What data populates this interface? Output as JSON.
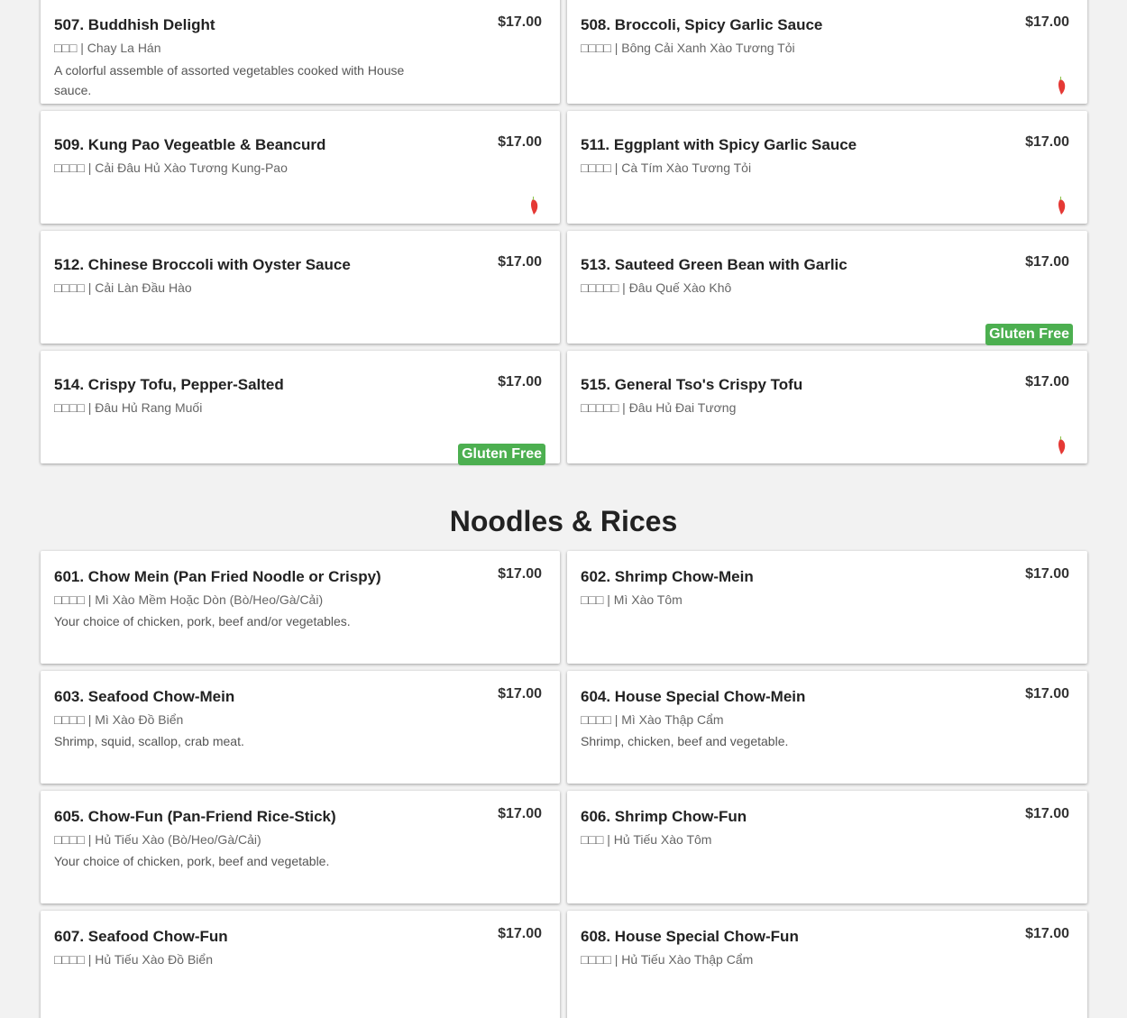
{
  "sections": [
    {
      "title": "",
      "items": [
        {
          "name": "507. Buddhish Delight",
          "price": "$17.00",
          "sub": "□□□ | Chay La Hán",
          "desc": "A colorful assemble of assorted vegetables cooked with House sauce.",
          "spicy": false,
          "gluten_free": false
        },
        {
          "name": "508. Broccoli, Spicy Garlic Sauce",
          "price": "$17.00",
          "sub": "□□□□ | Bông Cải Xanh Xào Tương Tỏi",
          "desc": "",
          "spicy": true,
          "gluten_free": false
        },
        {
          "name": "509. Kung Pao Vegeatble & Beancurd",
          "price": "$17.00",
          "sub": "□□□□ | Cải Đâu Hủ Xào Tương Kung-Pao",
          "desc": "",
          "spicy": true,
          "gluten_free": false
        },
        {
          "name": "511. Eggplant with Spicy Garlic Sauce",
          "price": "$17.00",
          "sub": "□□□□ | Cà Tím Xào Tương Tỏi",
          "desc": "",
          "spicy": true,
          "gluten_free": false
        },
        {
          "name": "512. Chinese Broccoli with Oyster Sauce",
          "price": "$17.00",
          "sub": "□□□□ | Cải Làn Đầu Hào",
          "desc": "",
          "spicy": false,
          "gluten_free": false
        },
        {
          "name": "513. Sauteed Green Bean with Garlic",
          "price": "$17.00",
          "sub": "□□□□□ | Đâu Quế Xào Khô",
          "desc": "",
          "spicy": false,
          "gluten_free": true
        },
        {
          "name": "514. Crispy Tofu, Pepper-Salted",
          "price": "$17.00",
          "sub": "□□□□ | Đâu Hủ Rang Muối",
          "desc": "",
          "spicy": false,
          "gluten_free": true
        },
        {
          "name": "515. General Tso's Crispy Tofu",
          "price": "$17.00",
          "sub": "□□□□□ | Đâu Hủ Đai Tương",
          "desc": "",
          "spicy": true,
          "gluten_free": false
        }
      ]
    },
    {
      "title": "Noodles & Rices",
      "items": [
        {
          "name": "601. Chow Mein (Pan Fried Noodle or Crispy)",
          "price": "$17.00",
          "sub": "□□□□ | Mì Xào Mềm Hoặc Dòn (Bò/Heo/Gà/Cải)",
          "desc": "Your choice of chicken, pork, beef and/or vegetables.",
          "spicy": false,
          "gluten_free": false
        },
        {
          "name": "602. Shrimp Chow-Mein",
          "price": "$17.00",
          "sub": "□□□ | Mì Xào Tôm",
          "desc": "",
          "spicy": false,
          "gluten_free": false
        },
        {
          "name": "603. Seafood Chow-Mein",
          "price": "$17.00",
          "sub": "□□□□ | Mì Xào Đồ Biển",
          "desc": "Shrimp, squid, scallop, crab meat.",
          "spicy": false,
          "gluten_free": false
        },
        {
          "name": "604. House Special Chow-Mein",
          "price": "$17.00",
          "sub": "□□□□ | Mì Xào Thập Cẩm",
          "desc": "Shrimp, chicken, beef and vegetable.",
          "spicy": false,
          "gluten_free": false
        },
        {
          "name": "605. Chow-Fun (Pan-Friend Rice-Stick)",
          "price": "$17.00",
          "sub": "□□□□ | Hủ Tiếu Xào (Bò/Heo/Gà/Cải)",
          "desc": "Your choice of chicken, pork, beef and vegetable.",
          "spicy": false,
          "gluten_free": false
        },
        {
          "name": "606. Shrimp Chow-Fun",
          "price": "$17.00",
          "sub": "□□□ | Hủ Tiếu Xào Tôm",
          "desc": "",
          "spicy": false,
          "gluten_free": false
        },
        {
          "name": "607. Seafood Chow-Fun",
          "price": "$17.00",
          "sub": "□□□□ | Hủ Tiếu Xào Đồ Biển",
          "desc": "",
          "spicy": false,
          "gluten_free": false
        },
        {
          "name": "608. House Special Chow-Fun",
          "price": "$17.00",
          "sub": "□□□□ | Hủ Tiếu Xào Thập Cẩm",
          "desc": "",
          "spicy": false,
          "gluten_free": false
        }
      ]
    }
  ],
  "gluten_free_label": "Gluten Free",
  "icons": {
    "spicy": "chili-pepper-icon"
  },
  "colors": {
    "gluten_free_badge": "#4caf50",
    "chili": "#e53935",
    "chili_stem": "#8bc34a",
    "background": "#f2f2f2",
    "card": "#ffffff"
  }
}
